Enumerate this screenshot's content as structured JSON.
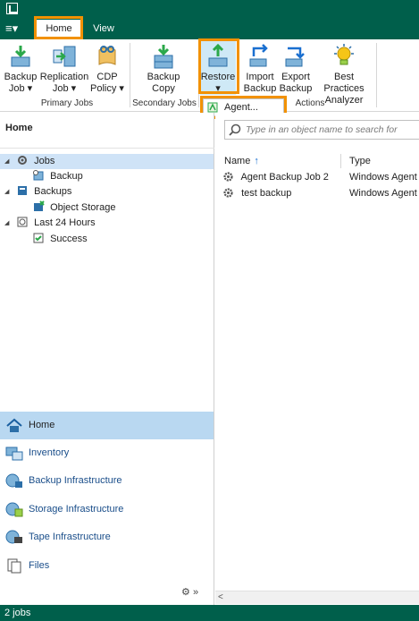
{
  "titlebar": {
    "logo_icon": "veeam-logo-icon"
  },
  "menubar": {
    "menu_icon": "≡▾",
    "tabs": [
      {
        "label": "Home",
        "active": true
      },
      {
        "label": "View",
        "active": false
      }
    ]
  },
  "ribbon": {
    "buttons": {
      "backup_job": {
        "line1": "Backup",
        "line2": "Job ▾"
      },
      "replication_job": {
        "line1": "Replication",
        "line2": "Job ▾"
      },
      "cdp_policy": {
        "line1": "CDP",
        "line2": "Policy ▾"
      },
      "backup_copy": {
        "line1": "Backup",
        "line2": "Copy"
      },
      "restore": {
        "line1": "Restore",
        "line2": "▾"
      },
      "import_backup": {
        "line1": "Import",
        "line2": "Backup"
      },
      "export_backup": {
        "line1": "Export",
        "line2": "Backup"
      },
      "best_practices": {
        "line1": "Best Practices",
        "line2": "Analyzer"
      }
    },
    "groups": {
      "primary": "Primary Jobs",
      "secondary": "Secondary Jobs",
      "actions": "Actions"
    }
  },
  "dropdown": {
    "items": [
      {
        "label": "Agent..."
      }
    ]
  },
  "left_pane": {
    "title": "Home",
    "tree": [
      {
        "label": "Jobs",
        "expanded": true,
        "selected": true
      },
      {
        "label": "Backup"
      },
      {
        "label": "Backups",
        "expanded": true
      },
      {
        "label": "Object Storage"
      },
      {
        "label": "Last 24 Hours",
        "expanded": true
      },
      {
        "label": "Success"
      }
    ],
    "nav": [
      {
        "label": "Home",
        "active": true
      },
      {
        "label": "Inventory"
      },
      {
        "label": "Backup Infrastructure"
      },
      {
        "label": "Storage Infrastructure"
      },
      {
        "label": "Tape Infrastructure"
      },
      {
        "label": "Files"
      }
    ],
    "nav_more": "»"
  },
  "right_pane": {
    "search_placeholder": "Type in an object name to search for",
    "columns": {
      "name": "Name",
      "name_sort": "↑",
      "type": "Type"
    },
    "rows": [
      {
        "name": "Agent Backup Job 2",
        "type": "Windows Agent B"
      },
      {
        "name": "test backup",
        "type": "Windows Agent B"
      }
    ],
    "scroll_left": "<"
  },
  "statusbar": {
    "text": "2 jobs"
  },
  "colors": {
    "brand_green": "#005f4b",
    "highlight_orange": "#f29100",
    "selection_blue": "#b9d8f1",
    "link_blue": "#1a4e8a"
  }
}
